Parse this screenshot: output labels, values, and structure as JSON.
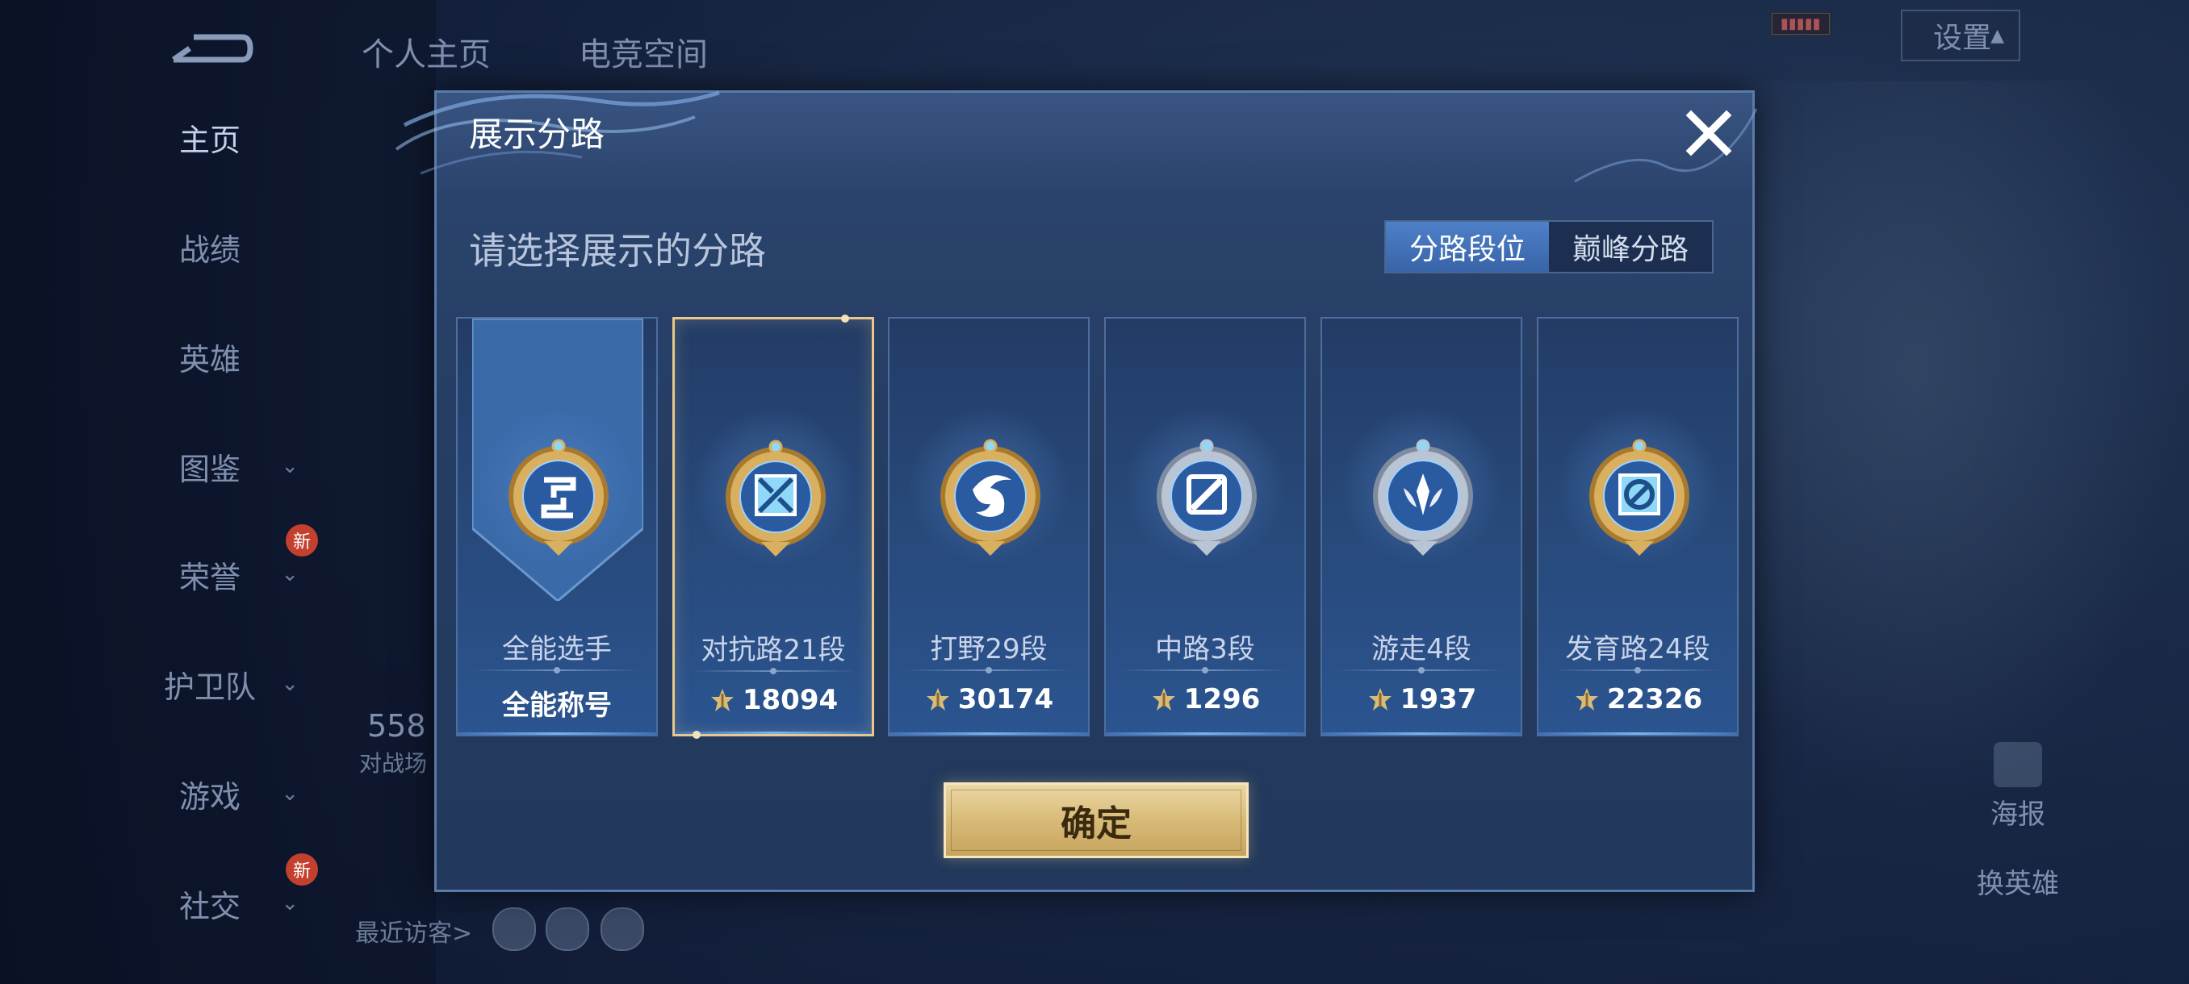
{
  "nav": {
    "items": [
      {
        "label": "主页",
        "has_chevron": false
      },
      {
        "label": "战绩",
        "has_chevron": false
      },
      {
        "label": "英雄",
        "has_chevron": false
      },
      {
        "label": "图鉴",
        "has_chevron": true
      },
      {
        "label": "荣誉",
        "has_chevron": true,
        "badge": "新"
      },
      {
        "label": "护卫队",
        "has_chevron": true
      },
      {
        "label": "游戏",
        "has_chevron": true
      },
      {
        "label": "社交",
        "has_chevron": true,
        "badge": "新"
      }
    ]
  },
  "top_tabs": [
    "个人主页",
    "电竞空间"
  ],
  "settings_label": "设置",
  "profile": {
    "number": "558",
    "sub": "对战场"
  },
  "recent_visitors_label": "最近访客>",
  "right_side": {
    "poster_label": "海报",
    "switch_hero_label": "换英雄"
  },
  "dialog": {
    "title": "展示分路",
    "subtitle": "请选择展示的分路",
    "toggle": {
      "active": "分路段位",
      "inactive": "巅峰分路"
    },
    "cards": [
      {
        "name": "全能选手",
        "value": "全能称号",
        "has_points_icon": false,
        "selected": false,
        "emblem": "all-round-emblem-icon"
      },
      {
        "name": "对抗路21段",
        "value": "18094",
        "has_points_icon": true,
        "selected": true,
        "emblem": "clash-lane-emblem-icon"
      },
      {
        "name": "打野29段",
        "value": "30174",
        "has_points_icon": true,
        "selected": false,
        "emblem": "jungle-emblem-icon"
      },
      {
        "name": "中路3段",
        "value": "1296",
        "has_points_icon": true,
        "selected": false,
        "emblem": "mid-lane-emblem-icon"
      },
      {
        "name": "游走4段",
        "value": "1937",
        "has_points_icon": true,
        "selected": false,
        "emblem": "roam-emblem-icon"
      },
      {
        "name": "发育路24段",
        "value": "22326",
        "has_points_icon": true,
        "selected": false,
        "emblem": "farm-lane-emblem-icon"
      }
    ],
    "confirm_label": "确定"
  },
  "colors": {
    "gold": "#d8bb78",
    "accent_blue": "#3864a8",
    "panel": "#263e64"
  }
}
